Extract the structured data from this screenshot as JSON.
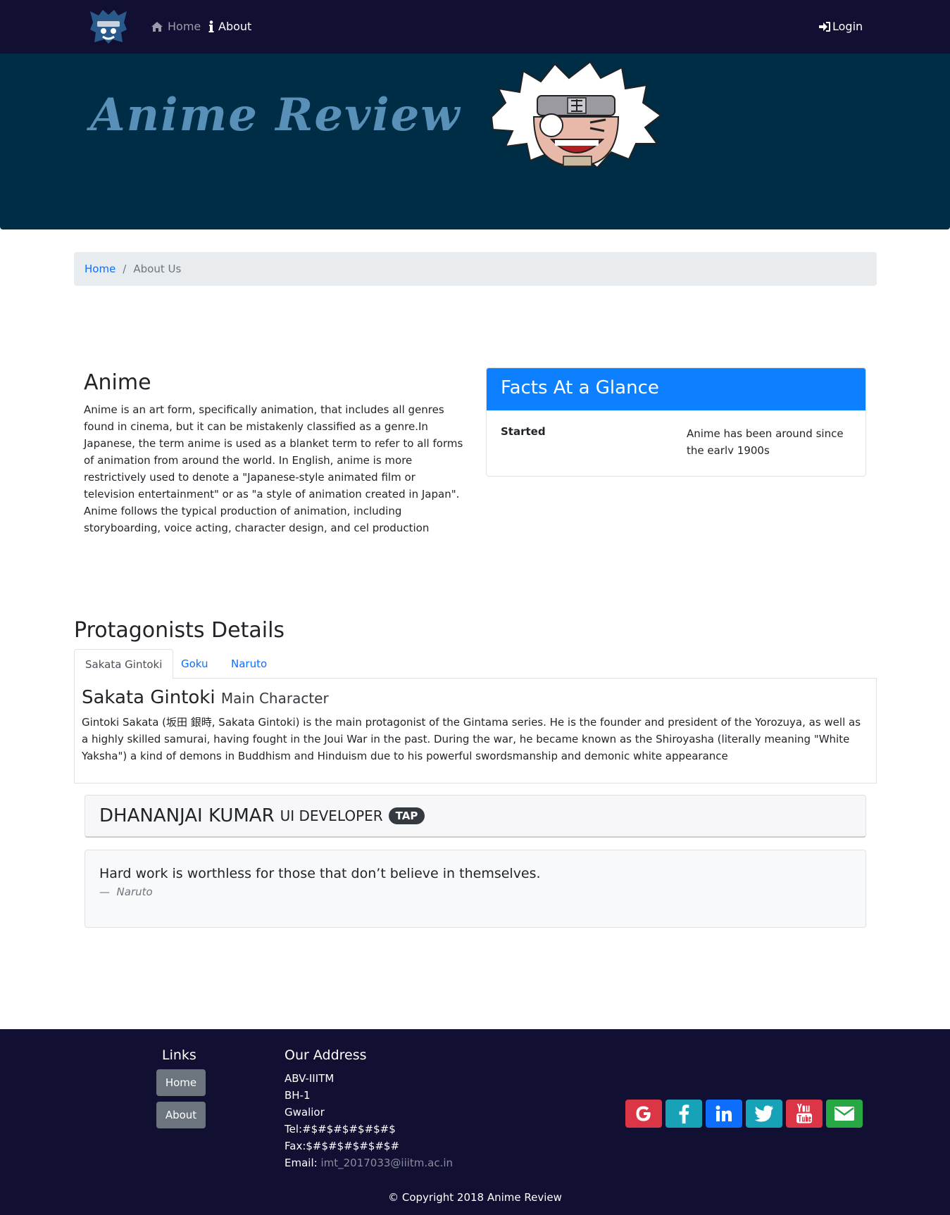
{
  "nav": {
    "home_label": "Home",
    "about_label": "About",
    "login_label": "Login"
  },
  "jumbotron": {
    "title": "Anime Review"
  },
  "breadcrumb": {
    "home": "Home",
    "separator": "/",
    "current": "About Us"
  },
  "anime": {
    "heading": "Anime",
    "paragraph1": "Anime is an art form, specifically animation, that includes all genres found in cinema, but it can be mistakenly classified as a genre.In Japanese, the term anime is used as a blanket term to refer to all forms of animation from around the world. In English, anime is more restrictively used to denote a \"Japanese-style animated film or television entertainment\" or as \"a style of animation created in Japan\".",
    "paragraph2": "Anime follows the typical production of animation, including storyboarding, voice acting, character design, and cel production"
  },
  "facts": {
    "title": "Facts At a Glance",
    "term": "Started",
    "value": "Anime has been around since the early 1900s"
  },
  "protagonists": {
    "heading": "Protagonists Details",
    "tabs": [
      "Sakata Gintoki",
      "Goku",
      "Naruto"
    ],
    "active_pane": {
      "name": "Sakata Gintoki",
      "subtitle": "Main Character",
      "text": "Gintoki Sakata (坂田 銀時, Sakata Gintoki) is the main protagonist of the Gintama series. He is the founder and president of the Yorozuya, as well as a highly skilled samurai, having fought in the Joui War in the past. During the war, he became known as the Shiroyasha (literally meaning \"White Yaksha\") a kind of demons in Buddhism and Hinduism due to his powerful swordsmanship and demonic white appearance"
    }
  },
  "developer": {
    "name": "DHANANJAI KUMAR",
    "role": "UI DEVELOPER",
    "badge": "TAP"
  },
  "quote": {
    "text": "Hard work is worthless for those that don’t believe in themselves.",
    "dash": "—",
    "source": "Naruto"
  },
  "footer": {
    "links_title": "Links",
    "links": [
      "Home",
      "About"
    ],
    "address_title": "Our Address",
    "address_lines": [
      "ABV-IIITM",
      "BH-1",
      "Gwalior",
      "Tel:#$#$#$#$#$#$",
      "Fax:$#$#$#$#$#$#"
    ],
    "email_label": "Email:",
    "email": "imt_2017033@iiitm.ac.in",
    "social_icons": [
      {
        "icon": "google-icon",
        "color": "#dc3545"
      },
      {
        "icon": "facebook-icon",
        "color": "#17a2b8"
      },
      {
        "icon": "linkedin-icon",
        "color": "#0d6efd"
      },
      {
        "icon": "twitter-icon",
        "color": "#17a2b8"
      },
      {
        "icon": "youtube-icon",
        "color": "#dc3545"
      },
      {
        "icon": "mail-icon",
        "color": "#28a745"
      }
    ],
    "copyright": "© Copyright 2018 Anime Review"
  }
}
